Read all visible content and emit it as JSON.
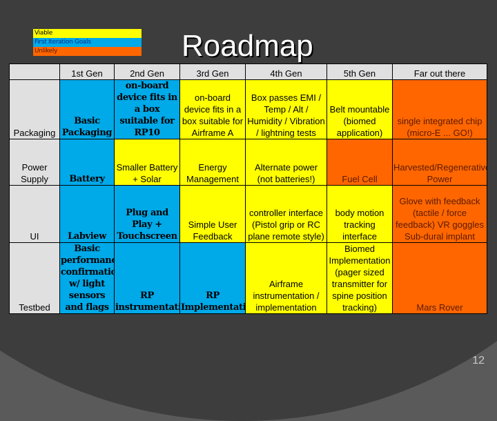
{
  "slide": {
    "title": "Roadmap",
    "page_number": "12"
  },
  "legend": [
    {
      "label": "Viable",
      "color": "#ffff00",
      "text_color": "#000000"
    },
    {
      "label": "First Iteration Goals",
      "color": "#00a9e8",
      "text_color": "#0a2a8a"
    },
    {
      "label": "Unlikely",
      "color": "#ff6600",
      "text_color": "#5a1a00"
    }
  ],
  "table": {
    "columns": [
      "",
      "1st Gen",
      "2nd Gen",
      "3rd Gen",
      "4th Gen",
      "5th Gen",
      "Far out there"
    ],
    "rows": [
      {
        "label": "Packaging",
        "cells": [
          {
            "text": "Basic Packaging",
            "status": "blue"
          },
          {
            "text": "on-board device fits in a box suitable for RP10",
            "status": "blue"
          },
          {
            "text": "on-board device fits in a box suitable for Airframe A",
            "status": "yellow"
          },
          {
            "text": "Box passes EMI / Temp / Alt / Humidity / Vibration / lightning tests",
            "status": "yellow"
          },
          {
            "text": "Belt mountable (biomed application)",
            "status": "yellow"
          },
          {
            "text": "single integrated chip (micro-E ... GO!)",
            "status": "orange"
          }
        ]
      },
      {
        "label": "Power Supply",
        "cells": [
          {
            "text": "Battery",
            "status": "blue"
          },
          {
            "text": "Smaller Battery + Solar",
            "status": "yellow"
          },
          {
            "text": "Energy Management",
            "status": "yellow"
          },
          {
            "text": "Alternate power (not batteries!)",
            "status": "yellow"
          },
          {
            "text": "Fuel Cell",
            "status": "orange"
          },
          {
            "text": "Harvested/Regenerative Power",
            "status": "orange"
          }
        ]
      },
      {
        "label": "UI",
        "cells": [
          {
            "text": "Labview",
            "status": "blue"
          },
          {
            "text": "Plug and Play + Touchscreen",
            "status": "blue"
          },
          {
            "text": "Simple User Feedback",
            "status": "yellow"
          },
          {
            "text": "controller interface (Pistol grip or RC plane remote style)",
            "status": "yellow"
          },
          {
            "text": "body motion tracking interface",
            "status": "yellow"
          },
          {
            "text": "Glove with feedback (tactile / force feedback) VR goggles Sub-dural implant",
            "status": "orange"
          }
        ]
      },
      {
        "label": "Testbed",
        "cells": [
          {
            "text": "Basic performance confirmation w/ light sensors and flags",
            "status": "blue"
          },
          {
            "text": "RP instrumentation",
            "status": "blue"
          },
          {
            "text": "RP Implementation",
            "status": "blue"
          },
          {
            "text": "Airframe instrumentation / implementation",
            "status": "yellow"
          },
          {
            "text": "Biomed Implementation (pager sized transmitter for spine position tracking)",
            "status": "yellow"
          },
          {
            "text": "Mars Rover",
            "status": "orange"
          }
        ]
      }
    ]
  }
}
